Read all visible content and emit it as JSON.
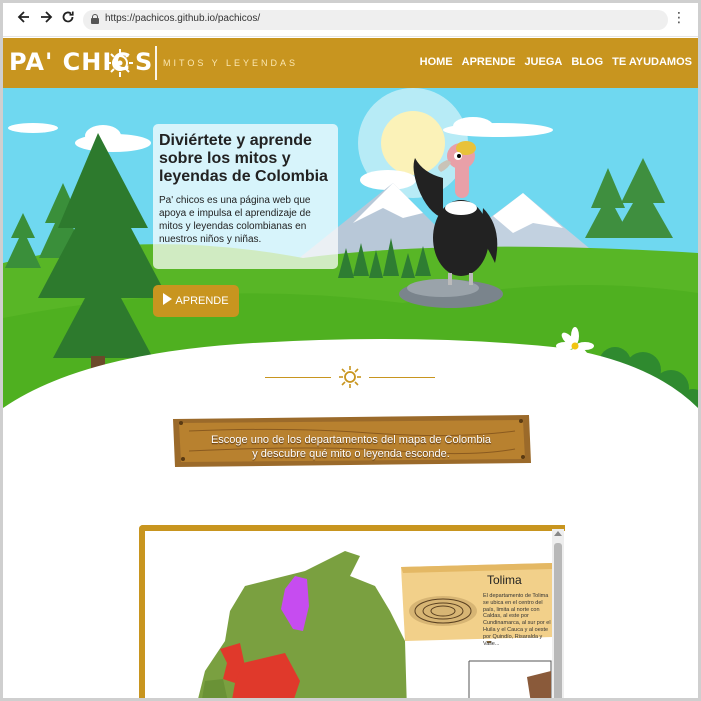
{
  "browser": {
    "url": "https://pachicos.github.io/pachicos/",
    "back_icon": "arrow-left-icon",
    "forward_icon": "arrow-right-icon",
    "reload_icon": "reload-icon",
    "menu_icon": "kebab-menu-icon"
  },
  "brand": {
    "logo_pa": "PA' CHIC",
    "logo_s": "S",
    "tagline": "MITOS Y LEYENDAS",
    "header_color": "#c8951f"
  },
  "nav": {
    "items": [
      "HOME",
      "APRENDE",
      "JUEGA",
      "BLOG",
      "TE AYUDAMOS"
    ]
  },
  "hero": {
    "title": "Diviértete y aprende sobre los mitos y leyendas de Colombia",
    "text": "Pa' chicos es una página web que apoya e impulsa el aprendizaje de mitos y leyendas colombianas en nuestros niños y niñas.",
    "button_label": "APRENDE"
  },
  "sign": {
    "line1": "Escoge uno de los departamentos del mapa de Colombia",
    "line2": "y descubre qué mito o leyenda esconde."
  },
  "map_panel": {
    "card_title": "Tolima",
    "card_text": "El departamento de Tolima se ubica en el centro del país, limita al norte con Caldas, al este por Cundinamarca, al sur por el Huila y el Cauca y al oeste por Quindío, Risaralda y Valle..."
  }
}
